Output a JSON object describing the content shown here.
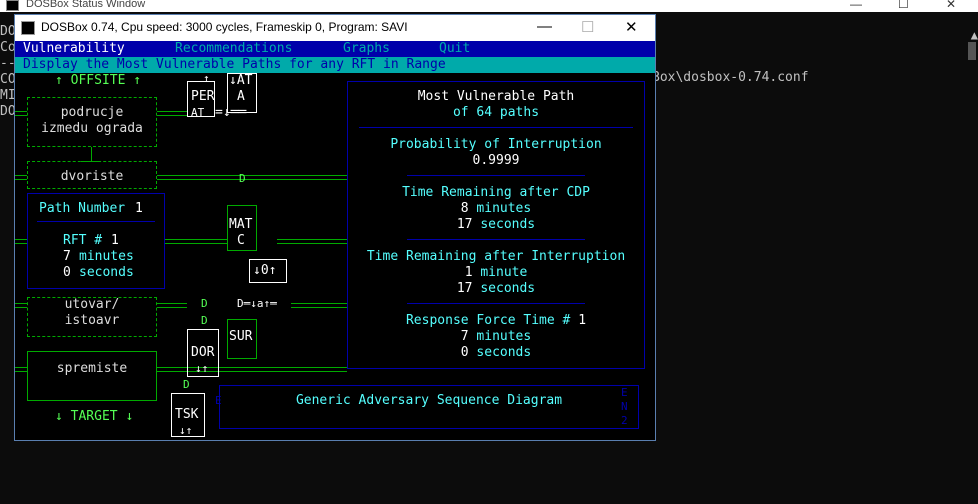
{
  "status_window": {
    "title": "DOSBox Status Window",
    "controls": {
      "minimize": "—",
      "maximize": "☐",
      "close": "✕"
    },
    "console_lines": [
      "DO",
      "Co",
      "--",
      "CO",
      "MI",
      "DO"
    ],
    "config_path_fragment": "Box\\dosbox-0.74.conf"
  },
  "dosbox_window": {
    "title": "DOSBox 0.74, Cpu speed:    3000 cycles, Frameskip  0, Program:    SAVI",
    "controls": {
      "minimize": "—",
      "maximize": "☐",
      "close": "✕"
    }
  },
  "menu": {
    "items": [
      {
        "label": "Vulnerability",
        "active": true
      },
      {
        "label": "Recommendations",
        "active": false
      },
      {
        "label": "Graphs",
        "active": false
      },
      {
        "label": "Quit",
        "active": false
      }
    ]
  },
  "hint": "Display the Most Vulnerable Paths for any RFT in Range",
  "path_diagram": {
    "offsite": "↑ OFFSITE ↑",
    "areas": [
      "podrucje",
      "izmedu ograda",
      "dvoriste",
      "utovar/",
      "istoavr",
      "spremiste"
    ],
    "target": "↓ TARGET ↓",
    "path_number": {
      "label": "Path Number",
      "value": "1"
    },
    "rft": {
      "label": "RFT #",
      "value": "1"
    },
    "minutes": {
      "value": "7",
      "unit": "minutes"
    },
    "seconds": {
      "value": "0",
      "unit": "seconds"
    }
  },
  "elements": {
    "per": {
      "label": "PER",
      "top": "↑",
      "side": "↓AT",
      "side2": "A",
      "bottom": "AT",
      "arrows": "=↓══"
    },
    "mat": {
      "label": "MAT",
      "d": "D",
      "sub": "C",
      "box": "↓0↑"
    },
    "sur": {
      "label": "SUR",
      "d": "D"
    },
    "dor": {
      "label": "DOR",
      "d": "D",
      "bottom": "↓↑"
    },
    "tsk": {
      "label": "TSK",
      "d": "D",
      "bottom": "↓↑"
    },
    "junction": "D═↓a↑═"
  },
  "results": {
    "header": "Most Vulnerable Path",
    "of_paths_prefix": "of",
    "of_paths_count": "64",
    "of_paths_suffix": "paths",
    "prob_label": "Probability of Interruption",
    "prob_value": "0.9999",
    "cdp_label": "Time Remaining after CDP",
    "cdp_minutes": "8",
    "cdp_minutes_unit": "minutes",
    "cdp_seconds": "17",
    "cdp_seconds_unit": "seconds",
    "int_label": "Time Remaining after Interruption",
    "int_minutes": "1",
    "int_minutes_unit": "minute",
    "int_seconds": "17",
    "int_seconds_unit": "seconds",
    "rft_label": "Response Force Time #",
    "rft_value": "1",
    "rft_minutes": "7",
    "rft_minutes_unit": "minutes",
    "rft_seconds": "0",
    "rft_seconds_unit": "seconds"
  },
  "sequence_diagram_label": "Generic Adversary Sequence Diagram",
  "side_letters": {
    "left": "E",
    "right": [
      "E",
      "N",
      "2"
    ]
  },
  "colors": {
    "menu_bg": "#0000aa",
    "menu_fg": "#00aaaa",
    "hint_bg": "#00aaaa",
    "green": "#00aa00",
    "cyan": "#55ffff",
    "white": "#ffffff"
  }
}
